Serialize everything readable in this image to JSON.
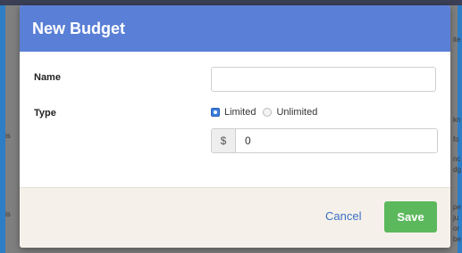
{
  "modal": {
    "title": "New Budget",
    "name_label": "Name",
    "name_value": "",
    "type_label": "Type",
    "type_options": [
      {
        "label": "Limited",
        "selected": true
      },
      {
        "label": "Unlimited",
        "selected": false
      }
    ],
    "currency_symbol": "$",
    "amount_value": "0",
    "cancel_label": "Cancel",
    "save_label": "Save"
  },
  "background": {
    "fragments": [
      "is",
      "is",
      "ite",
      "kn",
      "fo",
      "nc",
      "dg",
      "ju",
      "or",
      "be",
      "pe"
    ]
  },
  "colors": {
    "header": "#5a7fd6",
    "save": "#5cb85c",
    "cancel": "#3a6fc6",
    "radio_selected": "#3b7ddd",
    "footer": "#f5f1ea"
  }
}
